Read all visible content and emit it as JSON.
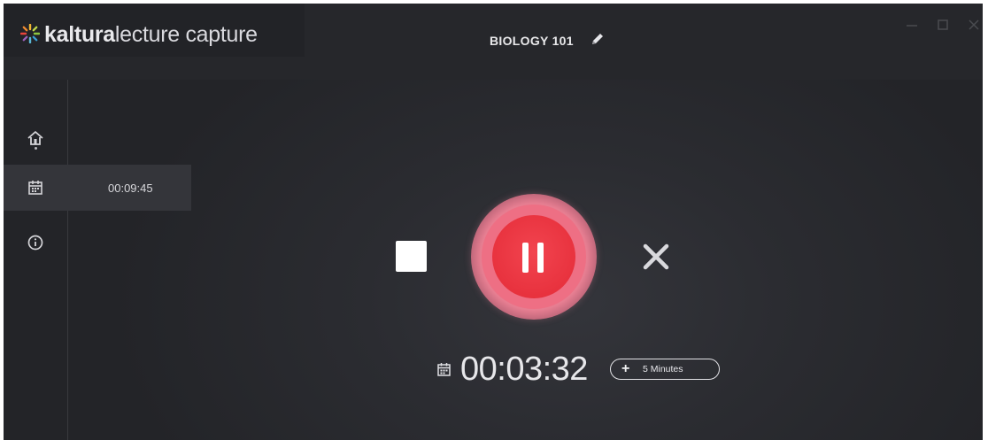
{
  "app": {
    "brand_bold": "kaltura",
    "brand_light": "lecture capture",
    "course_title": "BIOLOGY 101"
  },
  "sidebar": {
    "items": [
      {
        "name": "home",
        "icon": "home-icon"
      },
      {
        "name": "schedule",
        "icon": "calendar-icon"
      },
      {
        "name": "info",
        "icon": "info-icon"
      }
    ],
    "schedule_time": "00:09:45"
  },
  "recording": {
    "elapsed": "00:03:32",
    "extend_plus": "+",
    "extend_label": "5 Minutes",
    "controls": {
      "stop_icon": "stop-icon",
      "pause_icon": "pause-icon",
      "cancel_icon": "close-icon"
    }
  },
  "colors": {
    "record_red": "#e8323e",
    "record_ring": "#ee6f84",
    "background": "#2b2c31",
    "text": "#e7e7ea"
  }
}
